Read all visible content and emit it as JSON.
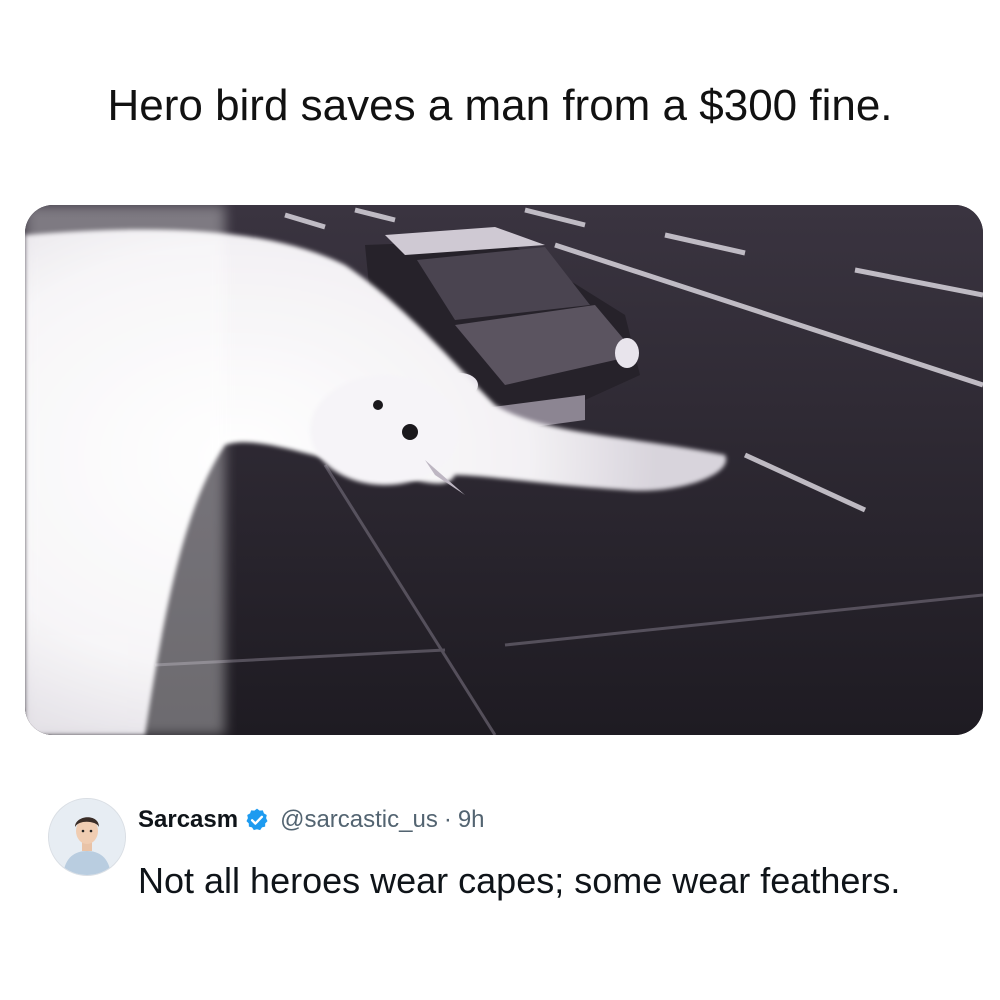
{
  "headline": "Hero bird saves a man from a $300 fine.",
  "photo": {
    "subject": "bird-icon"
  },
  "tweet": {
    "display_name": "Sarcasm",
    "verified_icon": "verified-badge-icon",
    "handle": "@sarcastic_us",
    "separator": "·",
    "time": "9h",
    "text": "Not all heroes wear capes; some wear feathers."
  },
  "colors": {
    "verified": "#1d9bf0",
    "handle": "#536471",
    "text": "#0f1419"
  }
}
